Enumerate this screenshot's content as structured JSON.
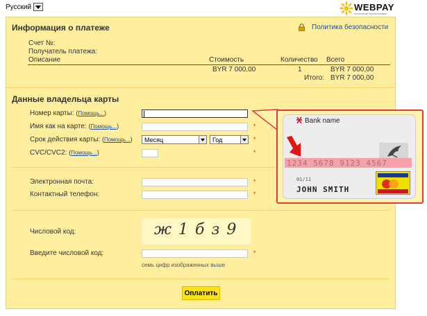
{
  "language": {
    "selected": "Русский"
  },
  "logo": {
    "text": "WEBPAY",
    "subtitle": "платежный мультисервис"
  },
  "payment_info": {
    "title": "Информация о платеже",
    "security_link": "Политика безопасности",
    "account_label": "Счет №:",
    "recipient_label": "Получатель платежа:",
    "table": {
      "headers": {
        "description": "Описание",
        "cost": "Стоимость",
        "quantity": "Количество",
        "total": "Всего"
      },
      "rows": [
        {
          "cost": "BYR 7 000,00",
          "quantity": "1",
          "total": "BYR 7 000,00"
        }
      ],
      "grand_total_label": "Итого:",
      "grand_total": "BYR 7 000,00"
    }
  },
  "cardholder": {
    "title": "Данные владельца карты",
    "help_link": "Помощь...",
    "card_number_label": "Номер карты:",
    "card_name_label": "Имя как на карте:",
    "expiry_label": "Срок действия карты:",
    "month_placeholder": "Месяц",
    "year_placeholder": "Год",
    "cvc_label": "CVC/CVC2:",
    "email_label": "Электронная почта:",
    "phone_label": "Контактный телефон:",
    "captcha_label": "Числовой код:",
    "captcha_input_label": "Введите числовой код:",
    "captcha_hint": "семь цифр изображенных выше",
    "captcha_text": "ж1бз9",
    "required_mark": "*"
  },
  "card_hint": {
    "bank_name": "Bank name",
    "number": "1234 5678 9123 4567",
    "expiry": "01/11",
    "holder": "JOHN SMITH"
  },
  "pay_button": "Оплатить",
  "colors": {
    "panel": "#ffee9e",
    "separator": "#f4d46a",
    "link": "#1a4fa3",
    "required": "#d9231d",
    "button": "#ffe21a",
    "hint_border": "#e33a3a"
  }
}
